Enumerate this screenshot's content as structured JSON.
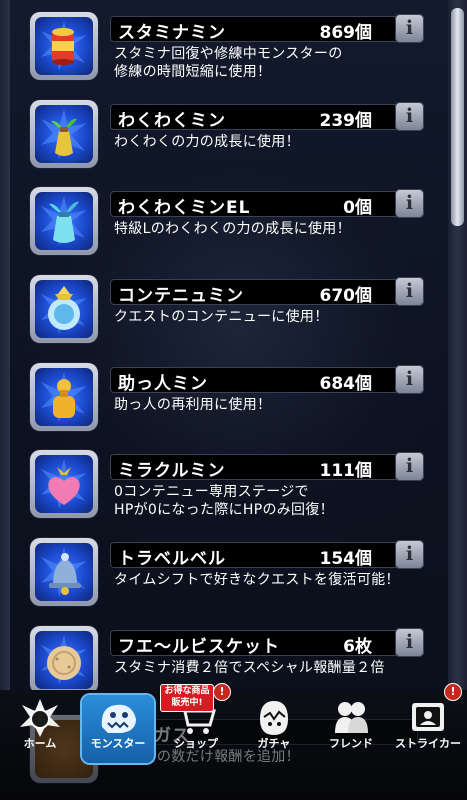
{
  "items": [
    {
      "name": "スタミナミン",
      "count": "869個",
      "desc": "スタミナ回復や修練中モンスターの\n修練の時間短縮に使用！",
      "icon": "stamina-can-icon",
      "info": "i"
    },
    {
      "name": "わくわくミン",
      "count": "239個",
      "desc": "わくわくの力の成長に使用！",
      "icon": "sprout-bottle-icon",
      "info": "i"
    },
    {
      "name": "わくわくミンEL",
      "count": "0個",
      "desc": "特級Lのわくわくの力の成長に使用！",
      "icon": "fish-bottle-icon",
      "info": "i"
    },
    {
      "name": "コンテニュミン",
      "count": "670個",
      "desc": "クエストのコンテニューに使用！",
      "icon": "crystal-jar-icon",
      "info": "i"
    },
    {
      "name": "助っ人ミン",
      "count": "684個",
      "desc": "助っ人の再利用に使用！",
      "icon": "helper-bottle-icon",
      "info": "i"
    },
    {
      "name": "ミラクルミン",
      "count": "111個",
      "desc": "0コンテニュー専用ステージで\nHPが0になった際にHPのみ回復！",
      "icon": "heart-bottle-icon",
      "info": "i"
    },
    {
      "name": "トラベルベル",
      "count": "154個",
      "desc": "タイムシフトで好きなクエストを復活可能！",
      "icon": "bell-icon",
      "info": "i"
    },
    {
      "name": "フエ～ルビスケット",
      "count": "6枚",
      "desc": "スタミナ消費２倍でスペシャル報酬量２倍",
      "icon": "biscuit-icon",
      "info": "i"
    }
  ],
  "ghost_row": {
    "name": "わくガス",
    "desc": "出に日の数だけ報酬を追加！"
  },
  "nav": [
    {
      "label": "ホーム",
      "icon": "home-icon",
      "active": false
    },
    {
      "label": "モンスター",
      "icon": "monster-icon",
      "active": true
    },
    {
      "label": "ショップ",
      "icon": "shop-cart-icon",
      "active": false
    },
    {
      "label": "ガチャ",
      "icon": "gacha-egg-icon",
      "active": false
    },
    {
      "label": "フレンド",
      "icon": "friend-icon",
      "active": false
    },
    {
      "label": "ストライカー",
      "icon": "striker-card-icon",
      "active": false
    }
  ],
  "sale_tag": "お得な商品\n販売中!",
  "badge_text": "!"
}
